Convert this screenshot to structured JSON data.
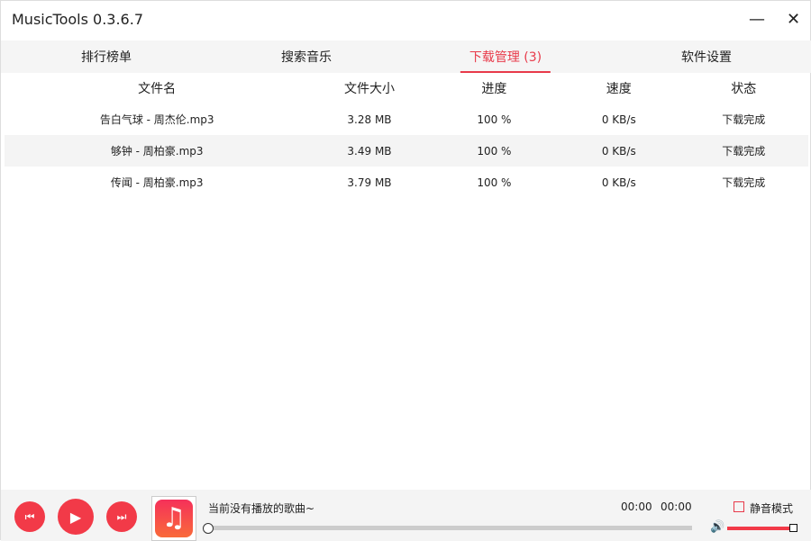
{
  "window": {
    "title": "MusicTools 0.3.6.7",
    "minimize_icon": "minimize-icon",
    "close_icon": "close-icon"
  },
  "tabs": [
    {
      "label": "排行榜单"
    },
    {
      "label": "搜索音乐"
    },
    {
      "label": "下载管理 (3)",
      "active": true
    },
    {
      "label": "软件设置"
    }
  ],
  "table": {
    "headers": [
      "文件名",
      "文件大小",
      "进度",
      "速度",
      "状态"
    ],
    "rows": [
      [
        "告白气球 - 周杰伦.mp3",
        "3.28 MB",
        "100 %",
        "0 KB/s",
        "下载完成"
      ],
      [
        "够钟 - 周柏豪.mp3",
        "3.49 MB",
        "100 %",
        "0 KB/s",
        "下载完成"
      ],
      [
        "传闻 - 周柏豪.mp3",
        "3.79 MB",
        "100 %",
        "0 KB/s",
        "下载完成"
      ]
    ]
  },
  "player": {
    "now_playing": "当前没有播放的歌曲~",
    "current_time": "00:00",
    "total_time": "00:00",
    "mode_label": "静音模式",
    "mode_checked": false,
    "progress": 0,
    "volume": 1.0,
    "accent": "#f23a48"
  }
}
